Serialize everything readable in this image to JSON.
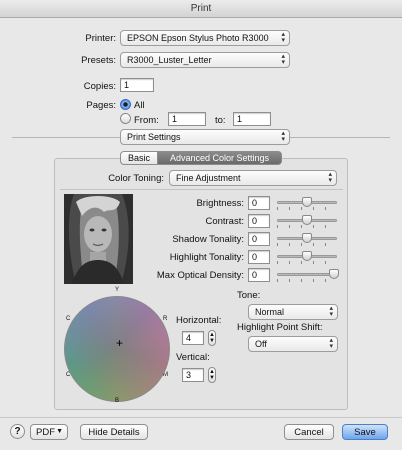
{
  "window": {
    "title": "Print"
  },
  "printer": {
    "label": "Printer:",
    "value": "EPSON Epson Stylus Photo R3000"
  },
  "presets": {
    "label": "Presets:",
    "value": "R3000_Luster_Letter"
  },
  "copies": {
    "label": "Copies:",
    "value": "1"
  },
  "pages": {
    "label": "Pages:",
    "all_label": "All",
    "from_label": "From:",
    "from_value": "1",
    "to_label": "to:",
    "to_value": "1"
  },
  "section_popup": {
    "value": "Print Settings"
  },
  "tabs": {
    "basic": "Basic",
    "advanced": "Advanced Color Settings"
  },
  "color_toning": {
    "label": "Color Toning:",
    "value": "Fine Adjustment"
  },
  "adjustments": [
    {
      "label": "Brightness:",
      "value": "0",
      "level": 0.5
    },
    {
      "label": "Contrast:",
      "value": "0",
      "level": 0.5
    },
    {
      "label": "Shadow Tonality:",
      "value": "0",
      "level": 0.5
    },
    {
      "label": "Highlight Tonality:",
      "value": "0",
      "level": 0.5
    },
    {
      "label": "Max Optical Density:",
      "value": "0",
      "level": 0.95
    }
  ],
  "wheel": {
    "top": "Y",
    "bottom": "B",
    "left_top": "C",
    "left_bottom": "C",
    "right_top": "R",
    "right_bottom": "M",
    "crosshair": "+"
  },
  "horizontal": {
    "label": "Horizontal:",
    "value": "4"
  },
  "vertical": {
    "label": "Vertical:",
    "value": "3"
  },
  "tone": {
    "label": "Tone:",
    "value": "Normal"
  },
  "highlight_shift": {
    "label": "Highlight Point Shift:",
    "value": "Off"
  },
  "footer": {
    "help": "?",
    "pdf": "PDF",
    "hide_details": "Hide Details",
    "cancel": "Cancel",
    "save": "Save"
  },
  "colors": {
    "accent": "#6da5ec",
    "selected_tab": "#7a7a7a"
  }
}
